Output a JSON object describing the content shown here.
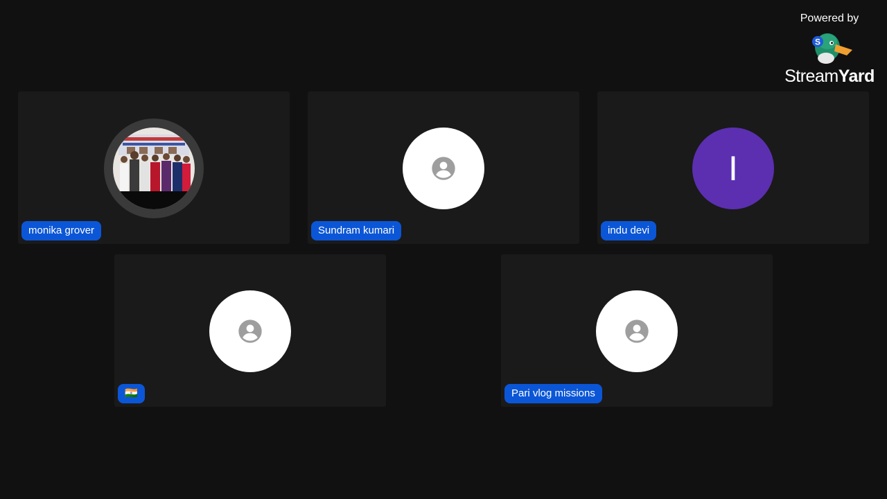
{
  "branding": {
    "powered_by": "Powered by",
    "logo_part1": "Stream",
    "logo_part2": "Yard",
    "mascot_badge": "S",
    "mascot_icon": "duck-mascot-icon"
  },
  "participants": [
    {
      "name": "monika grover",
      "avatar_type": "photo"
    },
    {
      "name": "Sundram kumari",
      "avatar_type": "default",
      "avatar_icon": "person-icon"
    },
    {
      "name": "indu devi",
      "avatar_type": "initial",
      "initial": "I",
      "avatar_color": "#5b2fb0"
    },
    {
      "name": "🇮🇳",
      "avatar_type": "default",
      "avatar_icon": "person-icon"
    },
    {
      "name": "Pari vlog missions",
      "avatar_type": "default",
      "avatar_icon": "person-icon"
    }
  ],
  "colors": {
    "background": "#111111",
    "tile": "#1a1a1a",
    "name_tag": "#0b56d6"
  }
}
